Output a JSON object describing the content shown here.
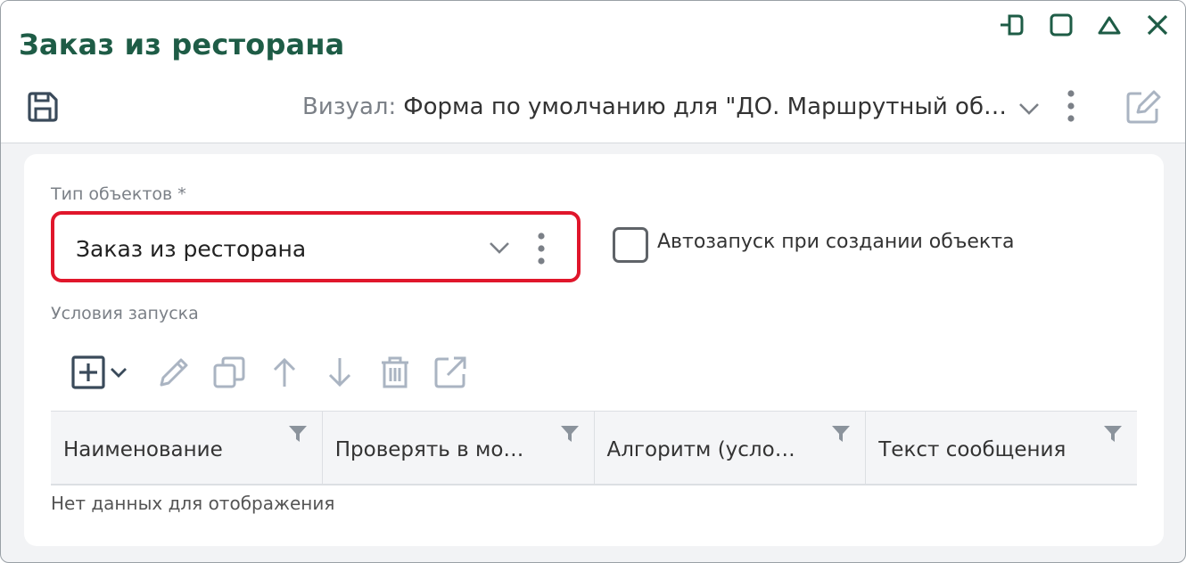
{
  "window": {
    "title": "Заказ из ресторана"
  },
  "toolbar": {
    "visual_label": "Визуал:",
    "visual_value": "Форма по умолчанию для \"ДО. Маршрутный об…"
  },
  "form": {
    "object_type_label": "Тип объектов *",
    "object_type_value": "Заказ из ресторана",
    "autostart_label": "Автозапуск при создании объекта",
    "autostart_checked": false,
    "conditions_label": "Условия запуска"
  },
  "grid": {
    "columns": [
      {
        "title": "Наименование"
      },
      {
        "title": "Проверять в мо…"
      },
      {
        "title": "Алгоритм (усло…"
      },
      {
        "title": "Текст сообщения"
      }
    ],
    "empty_text": "Нет данных для отображения"
  },
  "colors": {
    "title": "#1e5c46",
    "accent_border": "#e0162b",
    "icon_muted": "#aab4c2",
    "icon_dark": "#3a4a5a"
  }
}
